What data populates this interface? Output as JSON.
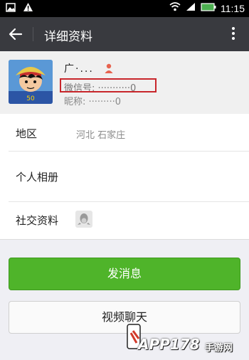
{
  "status_bar": {
    "time": "11:15",
    "icons": [
      "image-icon",
      "warning-icon",
      "wifi-icon",
      "signal-icon",
      "battery-icon"
    ]
  },
  "header": {
    "title": "详细资料",
    "back_icon": "back-arrow-icon",
    "more_icon": "more-vertical-icon"
  },
  "profile": {
    "name": "广·...",
    "gender_icon": "person-icon",
    "wechat_id": "微信号: ···········0",
    "nickname": "昵称: ·········0"
  },
  "info": {
    "region_label": "地区",
    "region_value": "河北  石家庄",
    "album_label": "个人相册",
    "social_label": "社交资料",
    "social_icon": "qq-penguin-icon"
  },
  "actions": {
    "send_message": "发消息",
    "video_chat": "视频聊天"
  },
  "watermark": {
    "brand": "APP178",
    "sub": "手游网"
  },
  "colors": {
    "titlebar": "#393a3f",
    "primary": "#4fb42a",
    "highlight": "#c8262b"
  }
}
